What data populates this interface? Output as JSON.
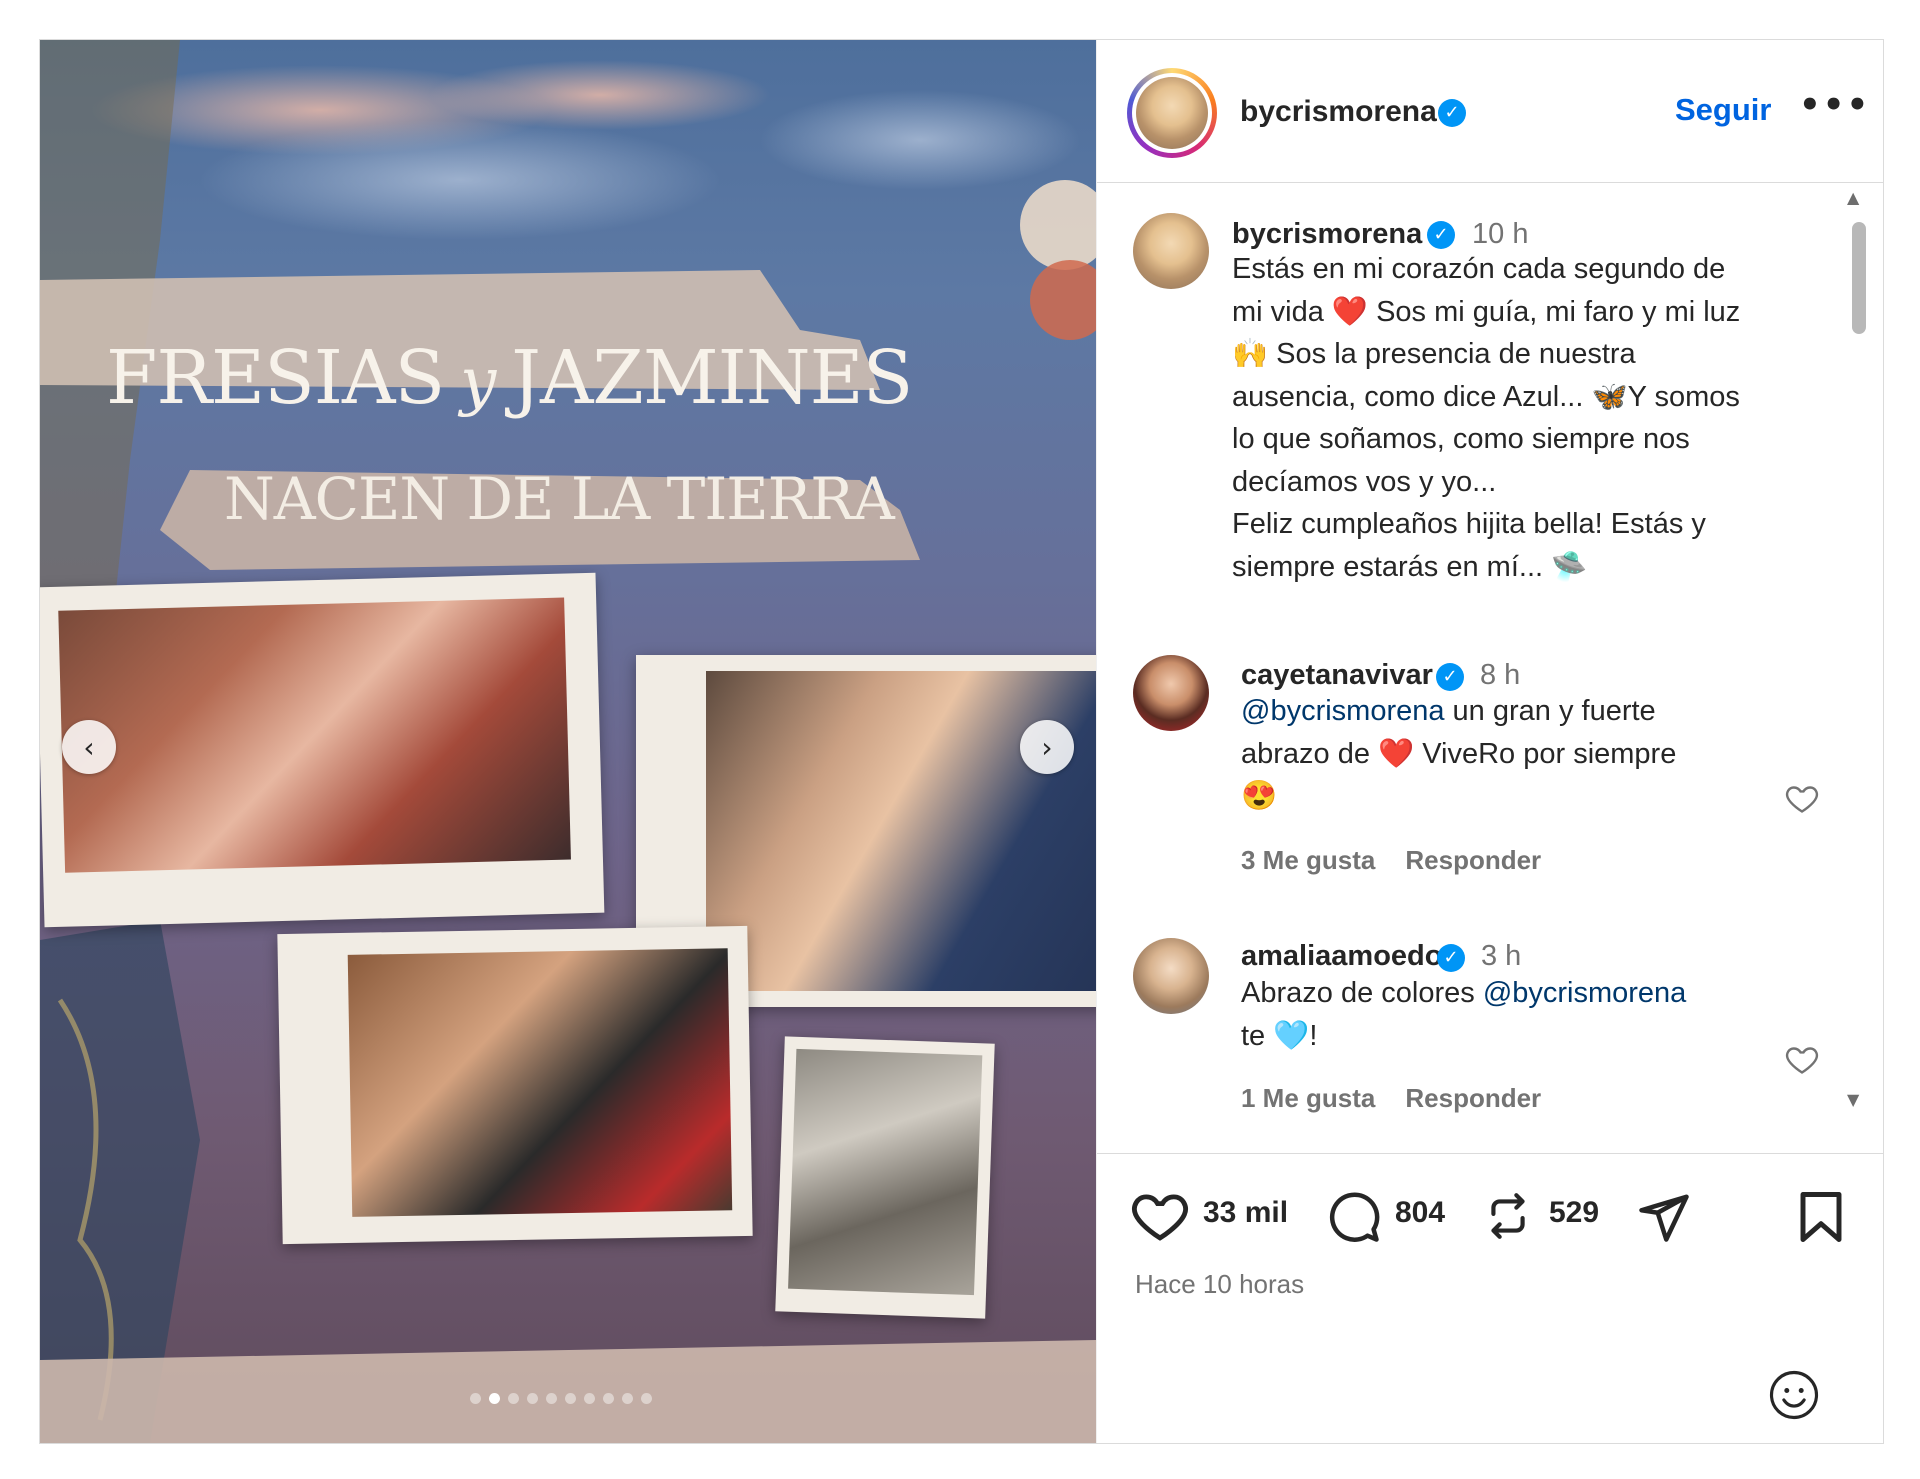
{
  "post": {
    "title_line1_a": "FRESIAS",
    "title_line1_b": "y",
    "title_line1_c": "JAZMINES",
    "title_line2": "NACEN DE LA TIERRA",
    "carousel_count": 10,
    "carousel_active": 2
  },
  "header": {
    "username": "bycrismorena",
    "follow_label": "Seguir",
    "more_label": "•••"
  },
  "caption": {
    "username": "bycrismorena",
    "time": "10 h",
    "lines": [
      "Estás en mi corazón cada segundo de",
      "mi vida ❤️  Sos mi guía, mi faro y mi luz",
      "🙌 Sos la presencia de nuestra",
      "ausencia, como dice Azul... 🦋Y somos",
      "lo que soñamos, como siempre nos",
      "decíamos vos y yo...",
      "Feliz cumpleaños hijita bella! Estás y",
      "siempre estarás en mí... 🛸"
    ]
  },
  "comments": [
    {
      "username": "cayetanavivar",
      "time": "8 h",
      "mention": "@bycrismorena",
      "text_after_mention": " un gran y fuerte",
      "line2": "abrazo de ❤️  ViveRo por siempre",
      "line3": "😍",
      "likes": "3 Me gusta",
      "reply": "Responder"
    },
    {
      "username": "amaliaamoedo",
      "time": "3 h",
      "text_before_mention": "Abrazo de colores ",
      "mention": "@bycrismorena",
      "line2": "te 🩵!",
      "likes": "1 Me gusta",
      "reply": "Responder"
    }
  ],
  "actions": {
    "likes": "33 mil",
    "comments": "804",
    "reposts": "529",
    "time_ago": "Hace 10 horas"
  },
  "colors": {
    "accent_link": "#0064e0",
    "verified": "#0095f6",
    "mention": "#00376b",
    "muted": "#737373"
  }
}
